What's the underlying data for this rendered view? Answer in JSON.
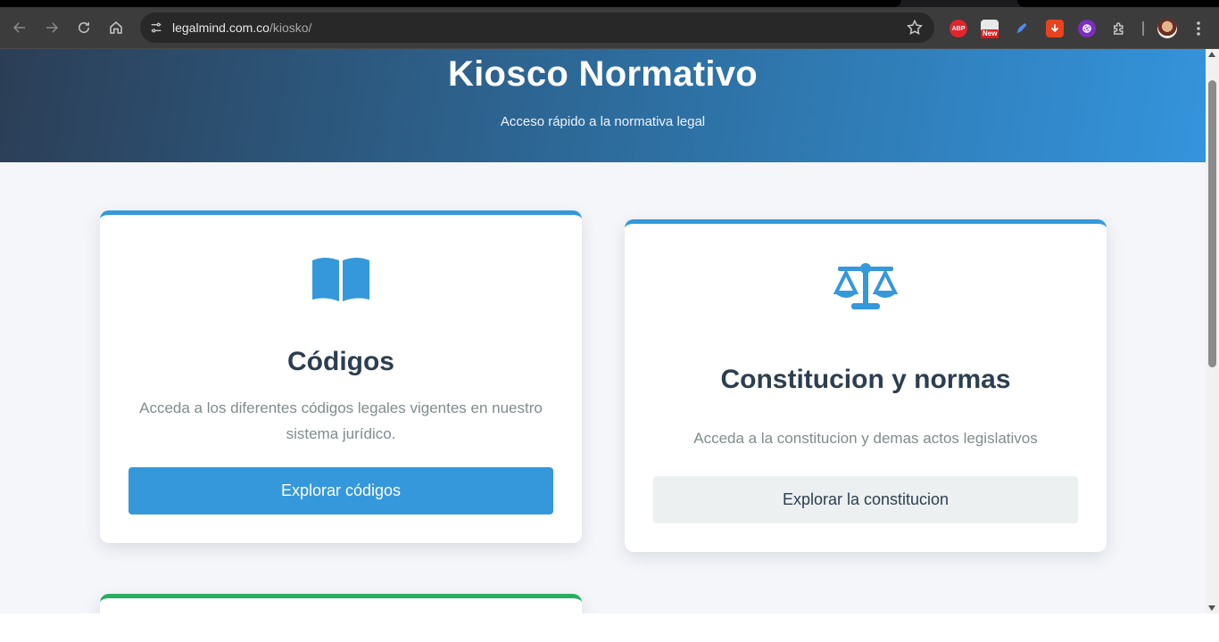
{
  "browser": {
    "url_host": "legalmind.com.co",
    "url_path": "/kiosko/",
    "extensions": {
      "abp_label": "ABP",
      "new_badge": "New"
    }
  },
  "hero": {
    "title": "Kiosco Normativo",
    "subtitle": "Acceso rápido a la normativa legal"
  },
  "cards": [
    {
      "icon": "book-icon",
      "title": "Códigos",
      "description": "Acceda a los diferentes códigos legales vigentes en nuestro sistema jurídico.",
      "button_label": "Explorar códigos"
    },
    {
      "icon": "scales-icon",
      "title": "Constitucion y normas",
      "description": "Acceda a la constitucion y demas actos legislativos",
      "button_label": "Explorar la constitucion"
    }
  ],
  "colors": {
    "accent": "#3498db",
    "title_text": "#2c3e50",
    "description_text": "#7f8c8d",
    "third_card_accent": "#27ae60"
  }
}
